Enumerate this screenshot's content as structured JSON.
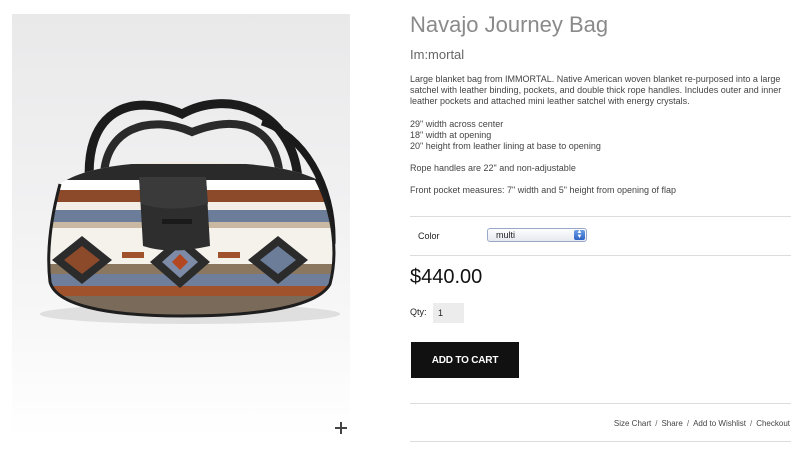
{
  "product": {
    "title": "Navajo Journey Bag",
    "brand": "Im:mortal",
    "description": [
      "Large blanket bag from IMMORTAL. Native American woven blanket re-purposed into a large satchel with leather binding, pockets, and double thick rope handles. Includes outer and inner leather pockets and attached mini leather satchel with energy crystals.",
      "29\" width across center\n18\" width at opening\n20\" height from leather lining at base to opening",
      "Rope handles are 22\" and non-adjustable",
      "Front pocket measures: 7\" width and 5\" height from opening of flap"
    ],
    "color_label": "Color",
    "color_selected": "multi",
    "price": "$440.00",
    "qty_label": "Qty:",
    "qty_value": "1",
    "add_to_cart_label": "ADD TO CART"
  },
  "footer_links": {
    "size_chart": "Size Chart",
    "share": "Share",
    "wishlist": "Add to Wishlist",
    "checkout": "Checkout",
    "separator": "/"
  },
  "colors": {
    "button_bg": "#111111",
    "title_color": "#8a8a8a",
    "select_arrow": "#2f63c4"
  },
  "icons": {
    "zoom": "plus-icon",
    "select_arrow": "chevron-updown-icon"
  }
}
